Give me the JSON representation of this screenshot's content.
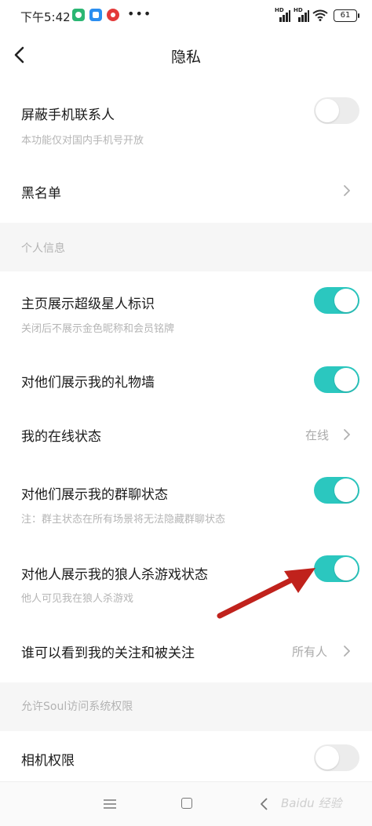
{
  "status_bar": {
    "time": "下午5:42",
    "more": "•••",
    "signal_label": "HD",
    "battery": "61",
    "icons": [
      "notification-app-green-icon",
      "notification-app-blue-icon",
      "notification-app-red-icon",
      "signal-icon",
      "signal-icon",
      "wifi-icon",
      "battery-icon"
    ]
  },
  "header": {
    "title": "隐私",
    "back_icon": "chevron-left-icon"
  },
  "rows": {
    "block_contacts": {
      "label": "屏蔽手机联系人",
      "desc": "本功能仅对国内手机号开放",
      "toggle": false
    },
    "blacklist": {
      "label": "黑名单"
    },
    "superstar_badge": {
      "label": "主页展示超级星人标识",
      "desc": "关闭后不展示金色昵称和会员铭牌",
      "toggle": true
    },
    "gift_wall": {
      "label": "对他们展示我的礼物墙",
      "toggle": true
    },
    "online_status": {
      "label": "我的在线状态",
      "value": "在线"
    },
    "group_chat_status": {
      "label": "对他们展示我的群聊状态",
      "desc": "注：群主状态在所有场景将无法隐藏群聊状态",
      "toggle": true
    },
    "werewolf_status": {
      "label": "对他人展示我的狼人杀游戏状态",
      "desc": "他人可见我在狼人杀游戏",
      "toggle": true
    },
    "follow_visibility": {
      "label": "谁可以看到我的关注和被关注",
      "value": "所有人"
    },
    "camera_permission": {
      "label": "相机权限",
      "toggle": false
    }
  },
  "sections": {
    "personal_info": "个人信息",
    "system_permissions": "允许Soul访问系统权限"
  },
  "nav_bar": {
    "icons": [
      "menu-icon",
      "home-square-icon",
      "back-triangle-icon"
    ],
    "watermark": "Baidu 经验"
  },
  "colors": {
    "toggle_on": "#2bc7bf",
    "toggle_off": "#ececec",
    "section_bg": "#f6f6f6",
    "annotation_arrow": "#c0221c"
  }
}
